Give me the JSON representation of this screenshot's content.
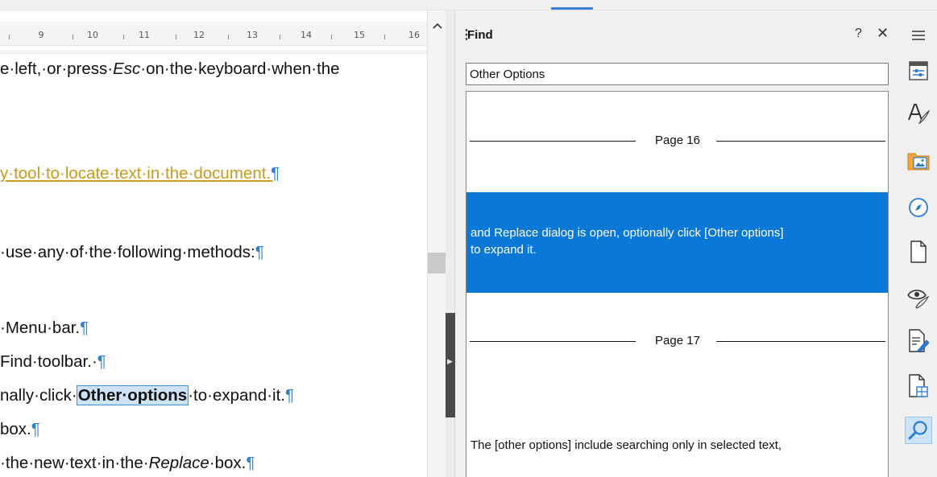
{
  "ruler": {
    "numbers": [
      "9",
      "10",
      "11",
      "12",
      "13",
      "14",
      "15",
      "16"
    ],
    "scroll_up_icon": "chevron-up-icon"
  },
  "document": {
    "line1": {
      "a": "e·left,·or·press·",
      "em": "Esc",
      "b": "·on·the·keyboard·when·the"
    },
    "line2": {
      "text": "y·tool·to·locate·text·in·the·document.",
      "pm": "¶"
    },
    "line3": {
      "text": "·use·any·of·the·following·methods:",
      "pm": "¶"
    },
    "line4": {
      "text": "·Menu·bar.",
      "pm": "¶"
    },
    "line5": {
      "text": "Find·toolbar.·",
      "pm": "¶"
    },
    "line6": {
      "a": "nally·click·",
      "hl": "Other·options",
      "b": "·to·expand·it.",
      "pm": "¶"
    },
    "line7": {
      "text": "box.",
      "pm": "¶"
    },
    "line8": {
      "a": "·the·new·text·in·the·",
      "em": "Replace",
      "b": "·box.",
      "pm": "¶"
    }
  },
  "find_panel": {
    "title": "Find",
    "help_label": "?",
    "close_label": "✕",
    "menu_icon": "hamburger-menu-icon",
    "search_value": "Other Options",
    "results": [
      {
        "type": "page",
        "label": "Page 16"
      },
      {
        "type": "match",
        "selected": true,
        "lines": [
          "and Replace dialog is open, optionally click [Other options]",
          "to expand it."
        ]
      },
      {
        "type": "page",
        "label": "Page 17"
      },
      {
        "type": "match",
        "selected": false,
        "lines": [
          "The [other options] include searching only in selected text,"
        ]
      }
    ]
  },
  "sidebar_tabs": [
    {
      "name": "properties-icon",
      "label": "Properties"
    },
    {
      "name": "styles-icon",
      "label": "Styles"
    },
    {
      "name": "gallery-icon",
      "label": "Gallery"
    },
    {
      "name": "navigator-icon",
      "label": "Navigator"
    },
    {
      "name": "page-icon",
      "label": "Page"
    },
    {
      "name": "style-inspector-icon",
      "label": "Style Inspector"
    },
    {
      "name": "manage-changes-icon",
      "label": "Manage Changes"
    },
    {
      "name": "design-icon",
      "label": "Design"
    },
    {
      "name": "find-icon",
      "label": "Find",
      "active": true
    }
  ],
  "colors": {
    "accent": "#0a78d7",
    "pilcrow": "#2f7fd6",
    "link": "#c99a1a"
  }
}
